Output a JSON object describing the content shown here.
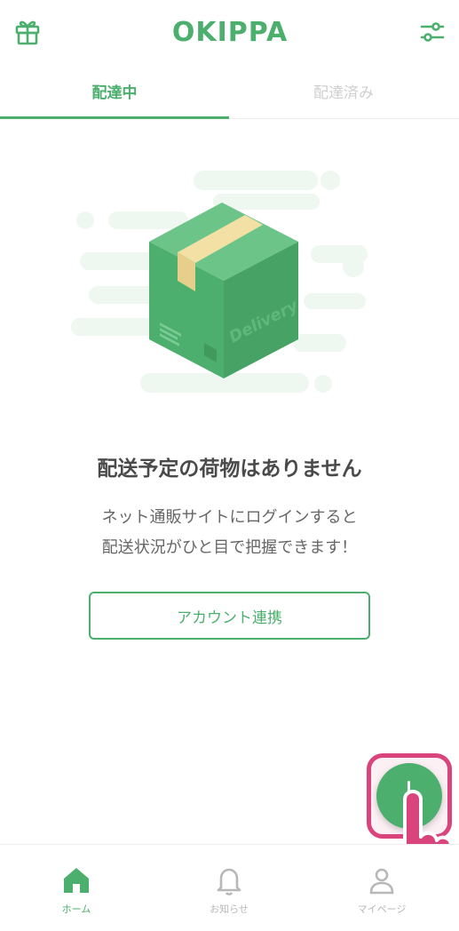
{
  "header": {
    "logo_text": "OKIPPA",
    "gift_icon": "gift-icon",
    "filter_icon": "sliders-icon"
  },
  "tabs": [
    {
      "label": "配達中",
      "active": true
    },
    {
      "label": "配達済み",
      "active": false
    }
  ],
  "illustration": {
    "box_label": "Delivery"
  },
  "empty_state": {
    "title": "配送予定の荷物はありません",
    "description_line1": "ネット通販サイトにログインすると",
    "description_line2": "配送状況がひと目で把握できます！",
    "button_label": "アカウント連携"
  },
  "bottom_nav": [
    {
      "label": "ホーム",
      "icon": "home-icon",
      "active": true
    },
    {
      "label": "お知らせ",
      "icon": "bell-icon",
      "active": false
    },
    {
      "label": "マイページ",
      "icon": "user-icon",
      "active": false
    }
  ],
  "colors": {
    "accent": "#4caf6e",
    "highlight": "#d9447c",
    "inactive": "#b8b8b8"
  }
}
